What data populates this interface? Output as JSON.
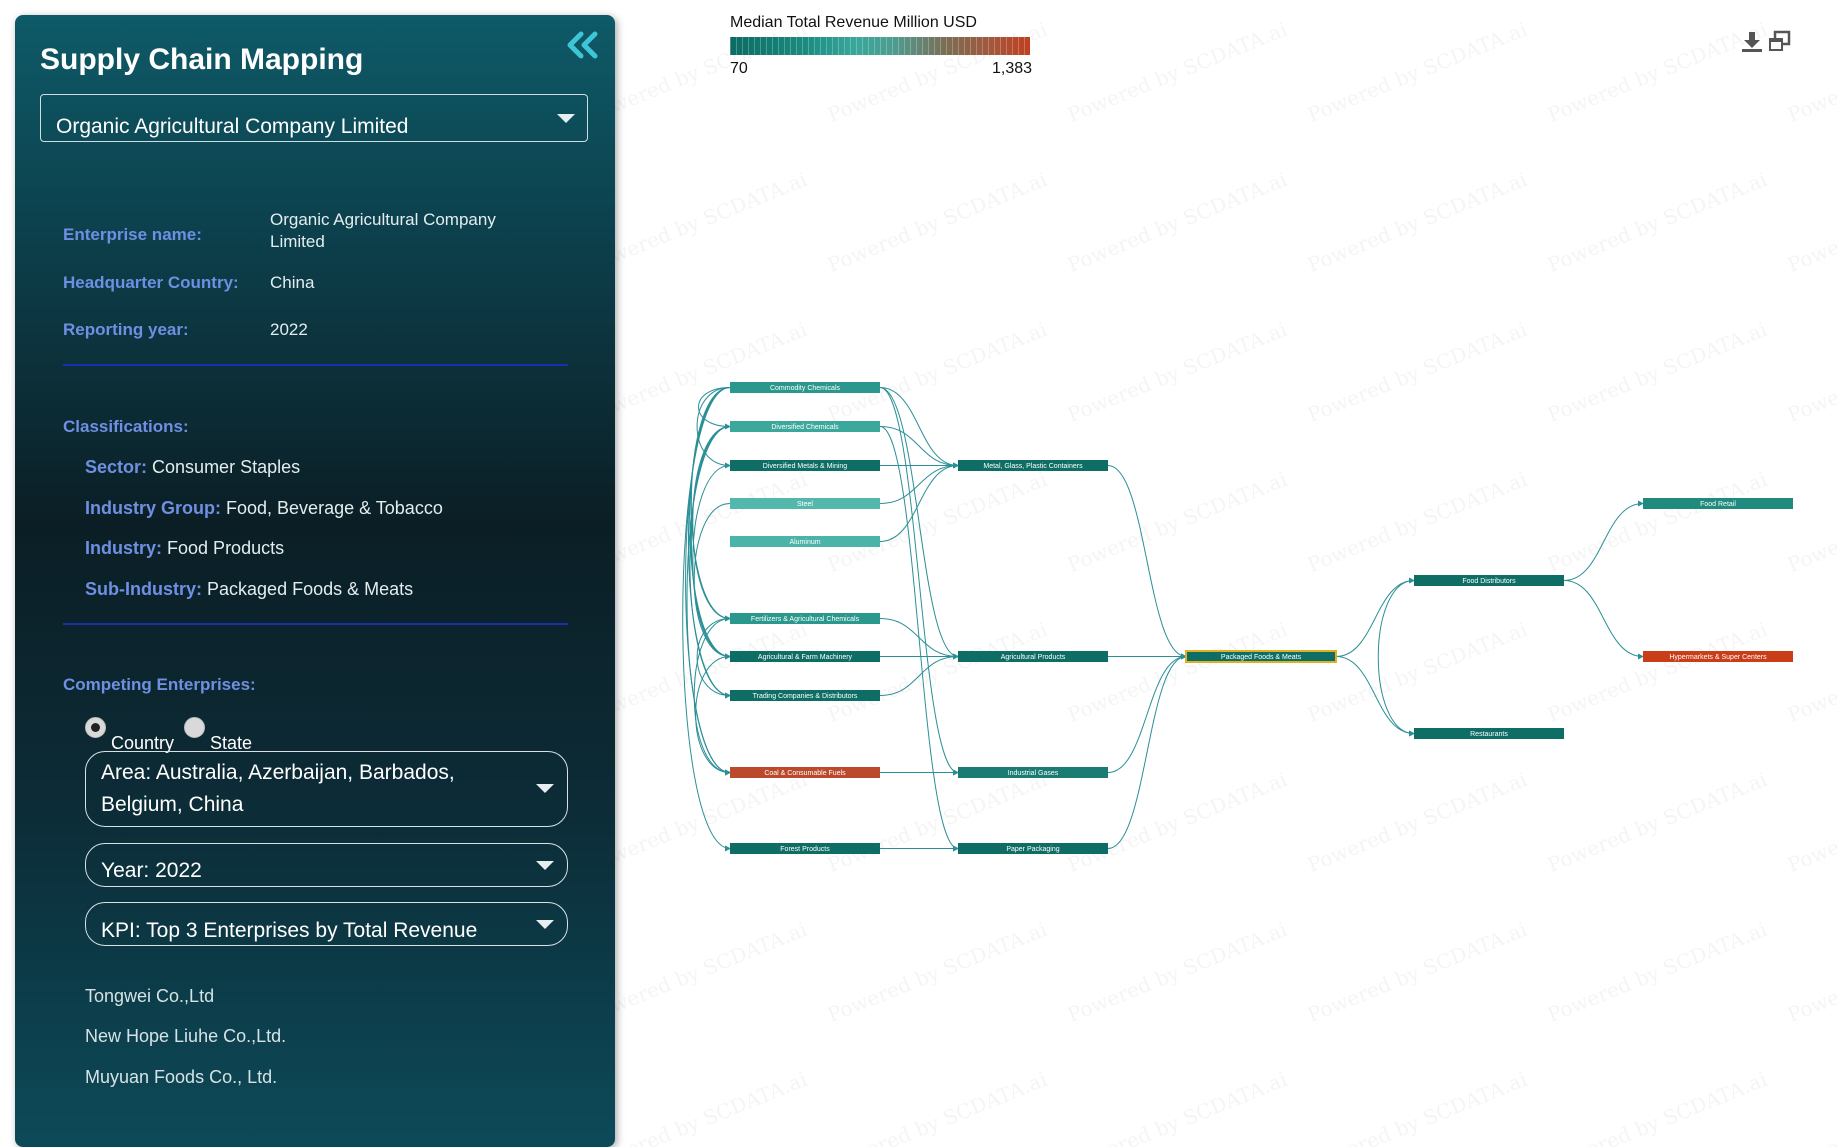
{
  "watermark": "Powered by SCDATA.ai",
  "panel": {
    "title": "Supply Chain Mapping",
    "company_select": "Organic Agricultural Company Limited",
    "enterprise_label": "Enterprise name:",
    "enterprise_value_line1": "Organic Agricultural Company",
    "enterprise_value_line2": "Limited",
    "hq_label": "Headquarter Country:",
    "hq_value": "China",
    "year_label": "Reporting year:",
    "year_value": "2022",
    "classifications_label": "Classifications:",
    "sector_label": "Sector:",
    "sector_value": "Consumer Staples",
    "industry_group_label": "Industry Group:",
    "industry_group_value": "Food, Beverage & Tobacco",
    "industry_label": "Industry:",
    "industry_value": "Food Products",
    "sub_industry_label": "Sub-Industry:",
    "sub_industry_value": "Packaged Foods & Meats",
    "competing_label": "Competing Enterprises:",
    "radio_country": "Country",
    "radio_state": "State",
    "area_line1": "Area: Australia, Azerbaijan, Barbados,",
    "area_line2": "Belgium, China",
    "year_select": "Year: 2022",
    "kpi_select": "KPI: Top 3 Enterprises by Total Revenue",
    "competitors": [
      "Tongwei Co.,Ltd",
      "New Hope Liuhe Co.,Ltd.",
      "Muyuan Foods Co., Ltd."
    ]
  },
  "legend": {
    "title": "Median Total Revenue Million USD",
    "min": "70",
    "max": "1,383"
  },
  "colors": {
    "dark_teal": "#0e6e65",
    "mid_teal": "#2a988c",
    "light_teal": "#4bb3a7",
    "orange": "#bb4a2c",
    "red_orange": "#c93e18",
    "highlight_border": "#e0b020",
    "edge": "#2a8f96"
  },
  "nodes": [
    {
      "id": "cc",
      "label": "Commodity Chemicals",
      "color": "#2a988c"
    },
    {
      "id": "dc",
      "label": "Diversified Chemicals",
      "color": "#3ca89b"
    },
    {
      "id": "dm",
      "label": "Diversified Metals & Mining",
      "color": "#0e6e65"
    },
    {
      "id": "st",
      "label": "Steel",
      "color": "#54b7ab"
    },
    {
      "id": "al",
      "label": "Aluminum",
      "color": "#4bb3a7"
    },
    {
      "id": "fa",
      "label": "Fertilizers & Agricultural Chemicals",
      "color": "#2a988c"
    },
    {
      "id": "afm",
      "label": "Agricultural & Farm Machinery",
      "color": "#0e6e65"
    },
    {
      "id": "tcd",
      "label": "Trading Companies & Distributors",
      "color": "#0e6e65"
    },
    {
      "id": "ccf",
      "label": "Coal & Consumable Fuels",
      "color": "#bb4a2c"
    },
    {
      "id": "fp",
      "label": "Forest Products",
      "color": "#0e6e65"
    },
    {
      "id": "mgp",
      "label": "Metal, Glass, Plastic Containers",
      "color": "#0e6e65"
    },
    {
      "id": "ap",
      "label": "Agricultural Products",
      "color": "#0e6e65"
    },
    {
      "id": "ig",
      "label": "Industrial Gases",
      "color": "#1a7c72"
    },
    {
      "id": "pp",
      "label": "Paper Packaging",
      "color": "#0e6e65"
    },
    {
      "id": "pfm",
      "label": "Packaged Foods & Meats",
      "color": "#0e6e65",
      "highlight": true
    },
    {
      "id": "fd",
      "label": "Food Distributors",
      "color": "#0e6e65"
    },
    {
      "id": "rs",
      "label": "Restaurants",
      "color": "#0e6e65"
    },
    {
      "id": "fr",
      "label": "Food Retail",
      "color": "#1f8a7e"
    },
    {
      "id": "hsc",
      "label": "Hypermarkets & Super Centers",
      "color": "#c93e18"
    }
  ],
  "edges": [
    [
      "cc",
      "mgp"
    ],
    [
      "dc",
      "mgp"
    ],
    [
      "dm",
      "mgp"
    ],
    [
      "st",
      "mgp"
    ],
    [
      "al",
      "mgp"
    ],
    [
      "fa",
      "ap"
    ],
    [
      "afm",
      "ap"
    ],
    [
      "tcd",
      "ap"
    ],
    [
      "ccf",
      "ig"
    ],
    [
      "fp",
      "pp"
    ],
    [
      "cc",
      "ig"
    ],
    [
      "dc",
      "pp"
    ],
    [
      "cc",
      "ap"
    ],
    [
      "mgp",
      "pfm"
    ],
    [
      "ap",
      "pfm"
    ],
    [
      "ig",
      "pfm"
    ],
    [
      "pp",
      "pfm"
    ],
    [
      "pfm",
      "fd"
    ],
    [
      "pfm",
      "rs"
    ],
    [
      "fd",
      "fr"
    ],
    [
      "fd",
      "hsc"
    ],
    [
      "fd",
      "rs"
    ],
    [
      "cc",
      "dc"
    ],
    [
      "cc",
      "dm"
    ],
    [
      "cc",
      "fa"
    ],
    [
      "cc",
      "afm"
    ],
    [
      "cc",
      "tcd"
    ],
    [
      "cc",
      "ccf"
    ],
    [
      "cc",
      "fp"
    ],
    [
      "dc",
      "fa"
    ],
    [
      "dc",
      "afm"
    ],
    [
      "dc",
      "tcd"
    ],
    [
      "dc",
      "ccf"
    ],
    [
      "dm",
      "afm"
    ],
    [
      "st",
      "afm"
    ],
    [
      "fa",
      "tcd"
    ],
    [
      "fa",
      "ccf"
    ],
    [
      "afm",
      "ccf"
    ]
  ]
}
